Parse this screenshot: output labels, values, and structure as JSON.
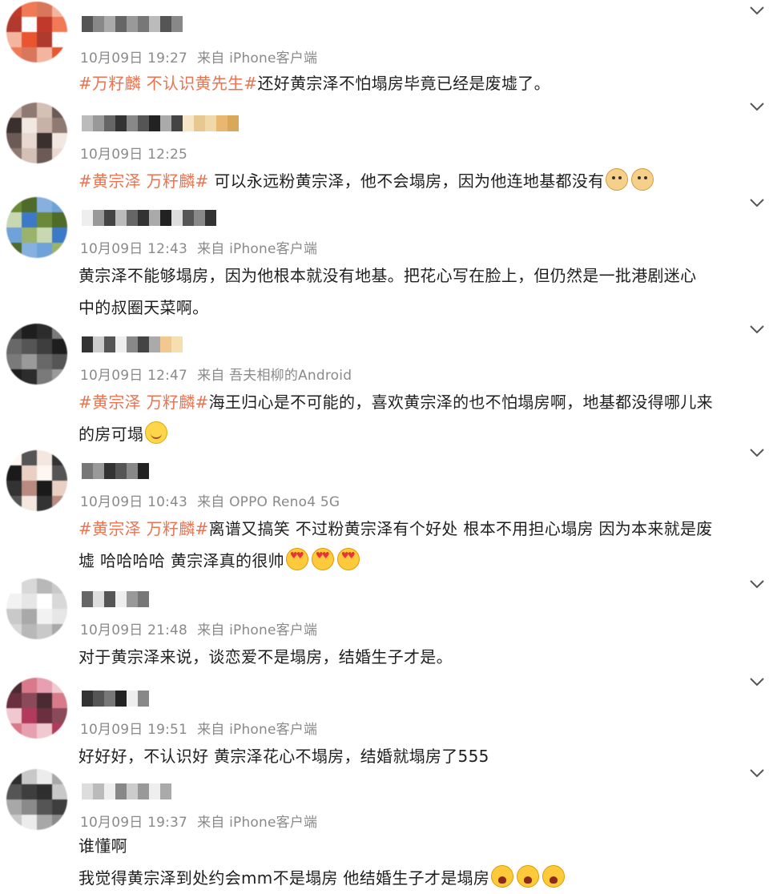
{
  "comments": [
    {
      "time": "10月09日 19:27",
      "source": "来自 iPhone客户端",
      "tags": "#万籽麟 不认识黄先生#",
      "text": "还好黄宗泽不怕塌房毕竟已经是废墟了。",
      "line2": ""
    },
    {
      "time": "10月09日 12:25",
      "source": "",
      "tags": "#黄宗泽 万籽麟#",
      "text": " 可以永远粉黄宗泽，他不会塌房，因为他连地基都没有",
      "line2": ""
    },
    {
      "time": "10月09日 12:43",
      "source": "来自 iPhone客户端",
      "tags": "",
      "text": "黄宗泽不能够塌房，因为他根本就没有地基。把花心写在脸上，但仍然是一批港剧迷心",
      "line2": "中的叔圈天菜啊。"
    },
    {
      "time": "10月09日 12:47",
      "source": "来自 吾夫相柳的Android",
      "tags": "#黄宗泽 万籽麟#",
      "text": "海王归心是不可能的，喜欢黄宗泽的也不怕塌房啊，地基都没得哪儿来",
      "line2": "的房可塌"
    },
    {
      "time": "10月09日 10:43",
      "source": "来自 OPPO Reno4 5G",
      "tags": "#黄宗泽 万籽麟#",
      "text": "离谱又搞笑 不过粉黄宗泽有个好处 根本不用担心塌房 因为本来就是废",
      "line2": "墟 哈哈哈哈 黄宗泽真的很帅"
    },
    {
      "time": "10月09日 21:48",
      "source": "来自 iPhone客户端",
      "tags": "",
      "text": "对于黄宗泽来说，谈恋爱不是塌房，结婚生子才是。",
      "line2": ""
    },
    {
      "time": "10月09日 19:51",
      "source": "来自 iPhone客户端",
      "tags": "",
      "text": "好好好，不认识好 黄宗泽花心不塌房，结婚就塌房了555",
      "line2": ""
    },
    {
      "time": "10月09日 19:37",
      "source": "来自 iPhone客户端",
      "tags": "",
      "text": "谁懂啊",
      "line2": "我觉得黄宗泽到处约会mm不是塌房 他结婚生子才是塌房"
    }
  ],
  "icons": {
    "chevron": "chevron-down-icon",
    "emoji_dog": "doge-emoji-icon",
    "emoji_smile": "smile-emoji-icon",
    "emoji_heart": "heart-eyes-emoji-icon",
    "emoji_cry": "crying-emoji-icon"
  },
  "colors": {
    "tag": "#eb7350",
    "meta": "#8a8a8a",
    "text": "#1f1f1f"
  }
}
